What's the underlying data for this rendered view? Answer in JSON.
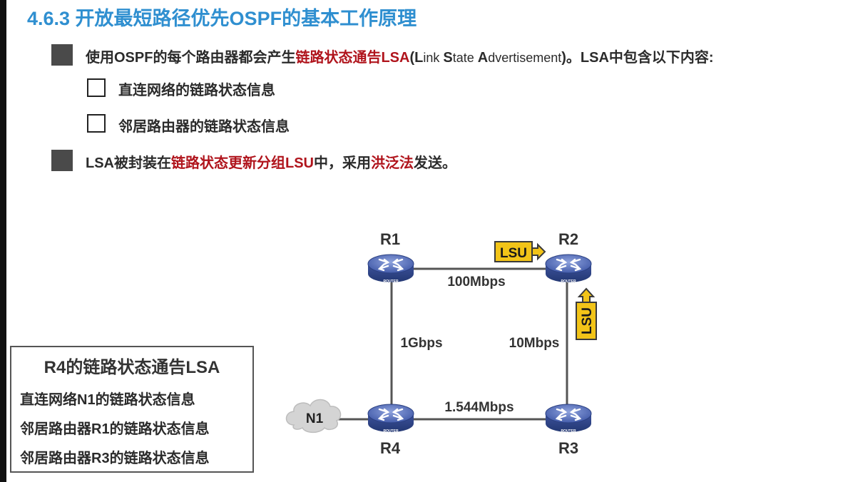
{
  "title": "4.6.3 开放最短路径优先OSPF的基本工作原理",
  "bullet1": {
    "prefix": "使用OSPF的每个路由器都会产生",
    "highlight": "链路状态通告LSA",
    "paren_open": "(",
    "en_L": "L",
    "en_ink": "ink ",
    "en_S": "S",
    "en_tate": "tate ",
    "en_A": "A",
    "en_dvert": "dvertisement",
    "suffix": ")。LSA中包含以下内容:"
  },
  "sub_items": [
    "直连网络的链路状态信息",
    "邻居路由器的链路状态信息"
  ],
  "bullet2": {
    "prefix": "LSA被封装在",
    "highlight1": "链路状态更新分组LSU",
    "middle": "中，采用",
    "highlight2": "洪泛法",
    "suffix": "发送。"
  },
  "diagram": {
    "routers": [
      "R1",
      "R2",
      "R3",
      "R4"
    ],
    "router_caption": "ROUTER",
    "network": "N1",
    "links": {
      "r1_r2": "100Mbps",
      "r1_r4": "1Gbps",
      "r2_r3": "10Mbps",
      "r4_r3": "1.544Mbps"
    },
    "packet_label": "LSU",
    "colors": {
      "router": "#4a63b0",
      "packet": "#f2c418",
      "link": "#555555",
      "cloud": "#cfcfcf"
    }
  },
  "lsa_box": {
    "title": "R4的链路状态通告LSA",
    "items": [
      "直连网络N1的链路状态信息",
      "邻居路由器R1的链路状态信息",
      "邻居路由器R3的链路状态信息"
    ]
  },
  "colors": {
    "title": "#2f8fd0",
    "highlight": "#b0141c",
    "text": "#2b2b2b"
  }
}
